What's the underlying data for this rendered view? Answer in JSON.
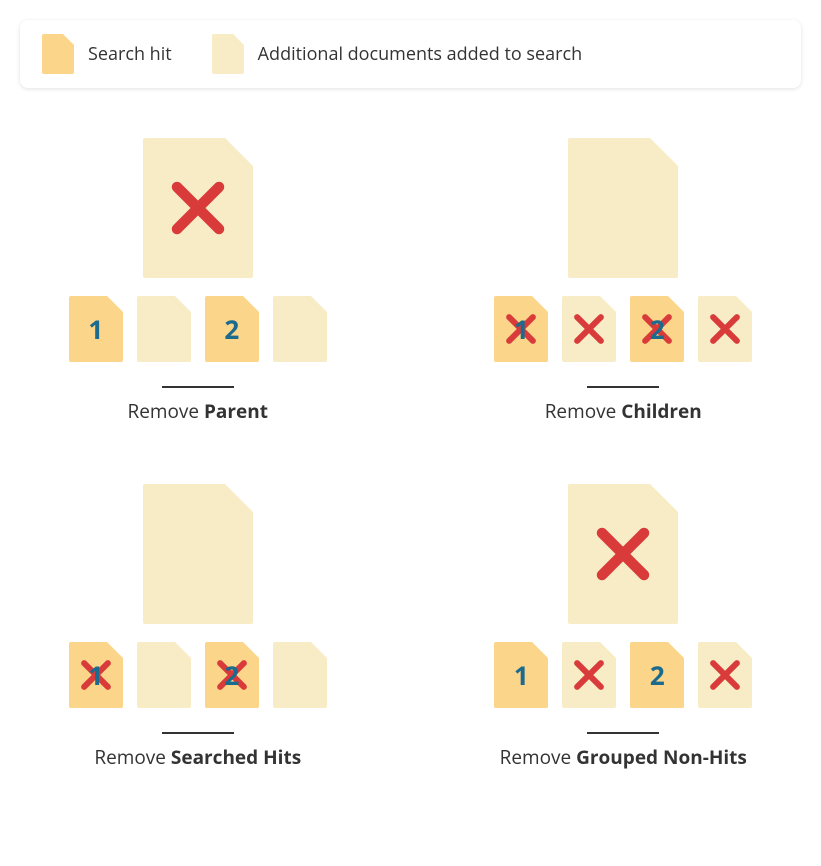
{
  "legend": {
    "hit": "Search hit",
    "added": "Additional documents added to search"
  },
  "panels": {
    "p1": {
      "caption_prefix": "Remove ",
      "caption_bold": "Parent"
    },
    "p2": {
      "caption_prefix": "Remove ",
      "caption_bold": "Children"
    },
    "p3": {
      "caption_prefix": "Remove ",
      "caption_bold": "Searched Hits"
    },
    "p4": {
      "caption_prefix": "Remove ",
      "caption_bold": "Grouped Non-Hits"
    }
  },
  "labels": {
    "one": "1",
    "two": "2"
  },
  "chart_data": {
    "type": "table",
    "note": "Four panels showing which docs get removed (X). Children are 4 docs; positions 1 and 3 are search hits labelled 1 and 2.",
    "panels": [
      {
        "name": "Remove Parent",
        "parent_removed": true,
        "children_removed": [
          false,
          false,
          false,
          false
        ]
      },
      {
        "name": "Remove Children",
        "parent_removed": false,
        "children_removed": [
          true,
          true,
          true,
          true
        ]
      },
      {
        "name": "Remove Searched Hits",
        "parent_removed": false,
        "children_removed": [
          true,
          false,
          true,
          false
        ]
      },
      {
        "name": "Remove Grouped Non-Hits",
        "parent_removed": true,
        "children_removed": [
          false,
          true,
          false,
          true
        ]
      }
    ]
  }
}
